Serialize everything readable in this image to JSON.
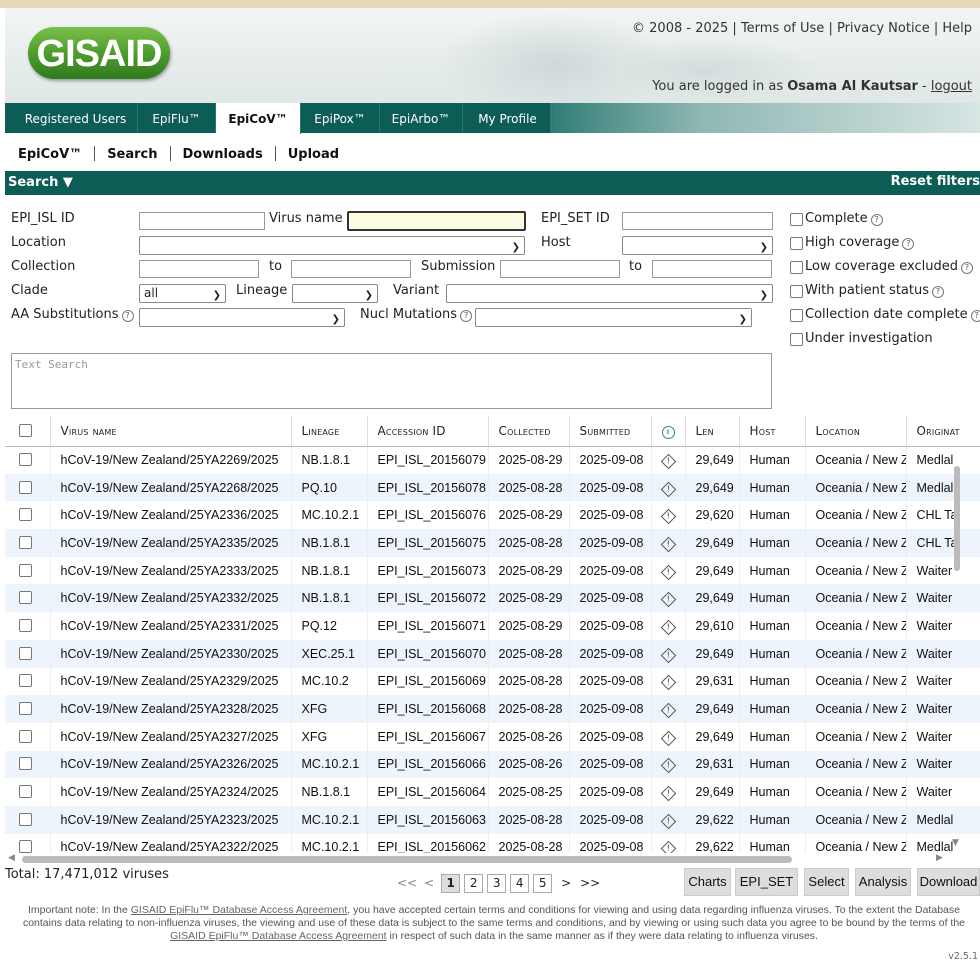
{
  "header": {
    "logo_text": "GISAID",
    "copyright": "© 2008 - 2025",
    "links": [
      "Terms of Use",
      "Privacy Notice",
      "Help"
    ],
    "logged_in_prefix": "You are logged in as",
    "user_name": "Osama Al Kautsar",
    "logout": "logout"
  },
  "main_tabs": [
    "Registered Users",
    "EpiFlu™",
    "EpiCoV™",
    "EpiPox™",
    "EpiArbo™",
    "My Profile"
  ],
  "active_tab": "EpiCoV™",
  "sub_nav": [
    "EpiCoV™",
    "Search",
    "Downloads",
    "Upload"
  ],
  "search_bar": {
    "title": "Search ▼",
    "reset": "Reset filters"
  },
  "filters": {
    "epi_isl_label": "EPI_ISL ID",
    "virus_name_label": "Virus name",
    "epi_set_label": "EPI_SET ID",
    "location_label": "Location",
    "host_label": "Host",
    "collection_label": "Collection",
    "to1": "to",
    "submission_label": "Submission",
    "to2": "to",
    "clade_label": "Clade",
    "clade_value": "all",
    "lineage_label": "Lineage",
    "variant_label": "Variant",
    "aa_label": "AA Substitutions",
    "nucl_label": "Nucl Mutations",
    "text_search_placeholder": "Text Search"
  },
  "checkboxes": [
    {
      "label": "Complete",
      "help": true
    },
    {
      "label": "High coverage",
      "help": true
    },
    {
      "label": "Low coverage excluded",
      "help": true
    },
    {
      "label": "With patient status",
      "help": true
    },
    {
      "label": "Collection date complete",
      "help": true
    },
    {
      "label": "Under investigation",
      "help": false
    }
  ],
  "table": {
    "columns": [
      "Virus name",
      "Lineage",
      "Accession ID",
      "Collected",
      "Submitted",
      "",
      "Len",
      "Host",
      "Location",
      "Originat"
    ],
    "rows": [
      [
        "hCoV-19/New Zealand/25YA2269/2025",
        "NB.1.8.1",
        "EPI_ISL_20156079",
        "2025-08-29",
        "2025-09-08",
        "29,649",
        "Human",
        "Oceania / New Z",
        "Medlal"
      ],
      [
        "hCoV-19/New Zealand/25YA2268/2025",
        "PQ.10",
        "EPI_ISL_20156078",
        "2025-08-28",
        "2025-09-08",
        "29,649",
        "Human",
        "Oceania / New Z",
        "Medlal"
      ],
      [
        "hCoV-19/New Zealand/25YA2336/2025",
        "MC.10.2.1",
        "EPI_ISL_20156076",
        "2025-08-29",
        "2025-09-08",
        "29,620",
        "Human",
        "Oceania / New Z",
        "CHL Ta"
      ],
      [
        "hCoV-19/New Zealand/25YA2335/2025",
        "NB.1.8.1",
        "EPI_ISL_20156075",
        "2025-08-28",
        "2025-09-08",
        "29,649",
        "Human",
        "Oceania / New Z",
        "CHL Ta"
      ],
      [
        "hCoV-19/New Zealand/25YA2333/2025",
        "NB.1.8.1",
        "EPI_ISL_20156073",
        "2025-08-29",
        "2025-09-08",
        "29,649",
        "Human",
        "Oceania / New Z",
        "Waiter"
      ],
      [
        "hCoV-19/New Zealand/25YA2332/2025",
        "NB.1.8.1",
        "EPI_ISL_20156072",
        "2025-08-29",
        "2025-09-08",
        "29,649",
        "Human",
        "Oceania / New Z",
        "Waiter"
      ],
      [
        "hCoV-19/New Zealand/25YA2331/2025",
        "PQ.12",
        "EPI_ISL_20156071",
        "2025-08-29",
        "2025-09-08",
        "29,610",
        "Human",
        "Oceania / New Z",
        "Waiter"
      ],
      [
        "hCoV-19/New Zealand/25YA2330/2025",
        "XEC.25.1",
        "EPI_ISL_20156070",
        "2025-08-28",
        "2025-09-08",
        "29,649",
        "Human",
        "Oceania / New Z",
        "Waiter"
      ],
      [
        "hCoV-19/New Zealand/25YA2329/2025",
        "MC.10.2",
        "EPI_ISL_20156069",
        "2025-08-28",
        "2025-09-08",
        "29,631",
        "Human",
        "Oceania / New Z",
        "Waiter"
      ],
      [
        "hCoV-19/New Zealand/25YA2328/2025",
        "XFG",
        "EPI_ISL_20156068",
        "2025-08-28",
        "2025-09-08",
        "29,649",
        "Human",
        "Oceania / New Z",
        "Waiter"
      ],
      [
        "hCoV-19/New Zealand/25YA2327/2025",
        "XFG",
        "EPI_ISL_20156067",
        "2025-08-26",
        "2025-09-08",
        "29,649",
        "Human",
        "Oceania / New Z",
        "Waiter"
      ],
      [
        "hCoV-19/New Zealand/25YA2326/2025",
        "MC.10.2.1",
        "EPI_ISL_20156066",
        "2025-08-26",
        "2025-09-08",
        "29,631",
        "Human",
        "Oceania / New Z",
        "Waiter"
      ],
      [
        "hCoV-19/New Zealand/25YA2324/2025",
        "NB.1.8.1",
        "EPI_ISL_20156064",
        "2025-08-25",
        "2025-09-08",
        "29,649",
        "Human",
        "Oceania / New Z",
        "Waiter"
      ],
      [
        "hCoV-19/New Zealand/25YA2323/2025",
        "MC.10.2.1",
        "EPI_ISL_20156063",
        "2025-08-28",
        "2025-09-08",
        "29,622",
        "Human",
        "Oceania / New Z",
        "Medlal"
      ],
      [
        "hCoV-19/New Zealand/25YA2322/2025",
        "MC.10.2.1",
        "EPI_ISL_20156062",
        "2025-08-28",
        "2025-09-08",
        "29,622",
        "Human",
        "Oceania / New Z",
        "Medlal"
      ]
    ]
  },
  "footer": {
    "total": "Total: 17,471,012 viruses",
    "pager_first": "<<",
    "pager_prev": "<",
    "pages": [
      "1",
      "2",
      "3",
      "4",
      "5"
    ],
    "current_page": "1",
    "pager_next": ">",
    "pager_last": ">>",
    "buttons": [
      "Charts",
      "EPI_SET",
      "Select",
      "Analysis",
      "Download"
    ],
    "note_parts": [
      "Important note: In the ",
      "GISAID EpiFlu™ Database Access Agreement",
      ", you have accepted certain terms and conditions for viewing and using data regarding influenza viruses. To the extent the Database contains data relating to non-influenza viruses, the viewing and use of these data is subject to the same terms and conditions, and by viewing or using such data you agree to be bound by the terms of the ",
      "GISAID EpiFlu™ Database Access Agreement",
      " in respect of such data in the same manner as if they were data relating to influenza viruses."
    ],
    "version": "v2.5.1"
  },
  "colors": {
    "brand_teal": "#0d5d57",
    "logo_green": "#4a9a2c",
    "row_alt": "#eef4fb"
  }
}
